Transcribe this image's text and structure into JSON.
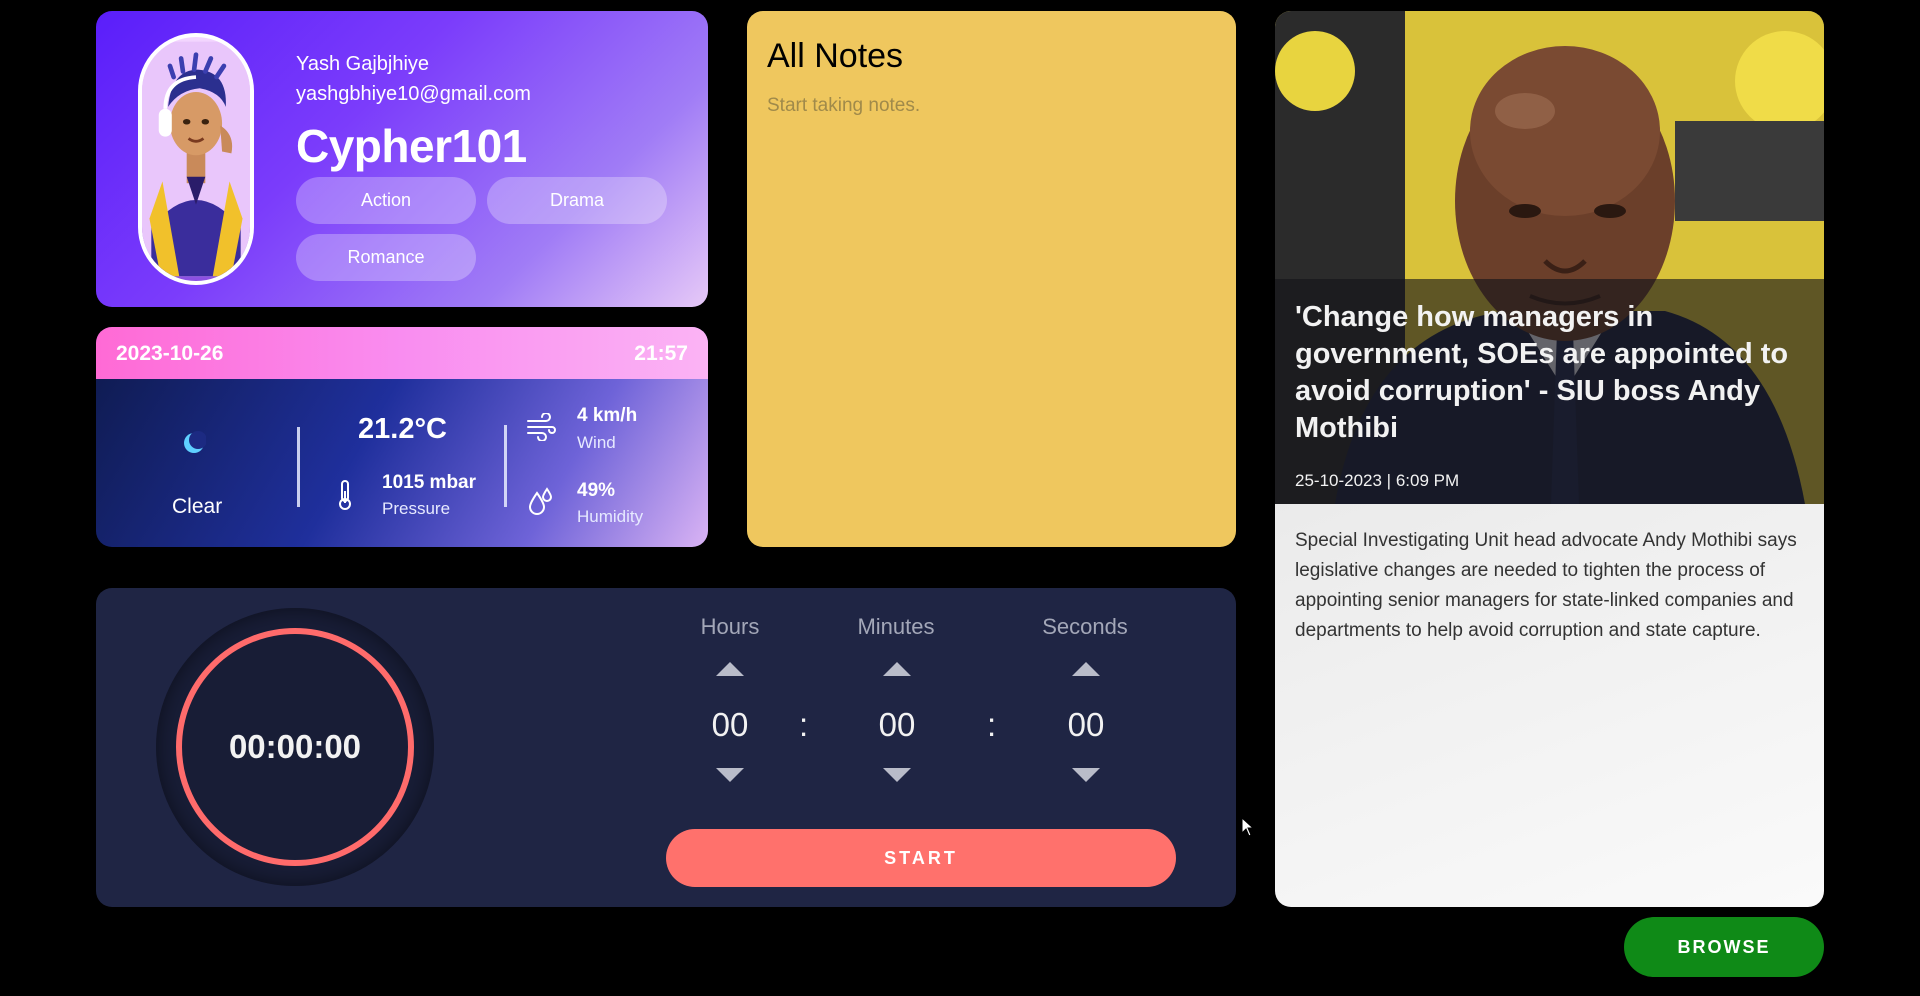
{
  "profile": {
    "name": "Yash Gajbjhiye",
    "email": "yashgbhiye10@gmail.com",
    "username": "Cypher101",
    "genres": [
      "Action",
      "Drama",
      "Romance"
    ]
  },
  "weather": {
    "date": "2023-10-26",
    "time": "21:57",
    "condition": "Clear",
    "condition_icon": "moon-icon",
    "temperature": "21.2°C",
    "pressure_value": "1015 mbar",
    "pressure_label": "Pressure",
    "wind_value": "4 km/h",
    "wind_label": "Wind",
    "humidity_value": "49%",
    "humidity_label": "Humidity"
  },
  "notes": {
    "title": "All Notes",
    "placeholder": "Start taking notes."
  },
  "news": {
    "title": "'Change how managers in government, SOEs are appointed to avoid corruption' - SIU boss Andy Mothibi",
    "date": "25-10-2023 | 6:09 PM",
    "description": "Special Investigating Unit head advocate Andy Mothibi says legislative changes are needed to tighten the process of appointing senior managers for state-linked companies and departments to help avoid corruption and state capture."
  },
  "timer": {
    "display": "00:00:00",
    "hours_label": "Hours",
    "minutes_label": "Minutes",
    "seconds_label": "Seconds",
    "hours": "00",
    "minutes": "00",
    "seconds": "00",
    "separator": ":",
    "start_label": "START"
  },
  "browse": {
    "label": "BROWSE"
  },
  "colors": {
    "profile_gradient_start": "#5a1efa",
    "notes_bg": "#efc75e",
    "timer_bg": "#1f2544",
    "timer_accent": "#ff6b6b",
    "browse_bg": "#0f8a17",
    "weather_header": "#ff6ad5"
  }
}
